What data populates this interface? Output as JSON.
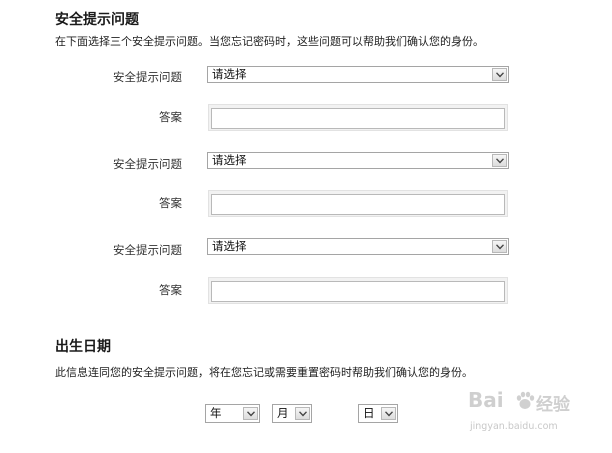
{
  "security": {
    "heading": "安全提示问题",
    "description": "在下面选择三个安全提示问题。当您忘记密码时，这些问题可以帮助我们确认您的身份。",
    "questions": [
      {
        "label": "安全提示问题",
        "selected": "请选择",
        "answer_label": "答案",
        "answer_value": ""
      },
      {
        "label": "安全提示问题",
        "selected": "请选择",
        "answer_label": "答案",
        "answer_value": ""
      },
      {
        "label": "安全提示问题",
        "selected": "请选择",
        "answer_label": "答案",
        "answer_value": ""
      }
    ]
  },
  "birthday": {
    "heading": "出生日期",
    "description": "此信息连同您的安全提示问题，将在您忘记或需要重置密码时帮助我们确认您的身份。",
    "year": "年",
    "month": "月",
    "day": "日"
  },
  "watermark": {
    "brand": "Bai",
    "cn": "经验",
    "url": "jingyan.baidu.com",
    "icon": "paw-icon"
  }
}
